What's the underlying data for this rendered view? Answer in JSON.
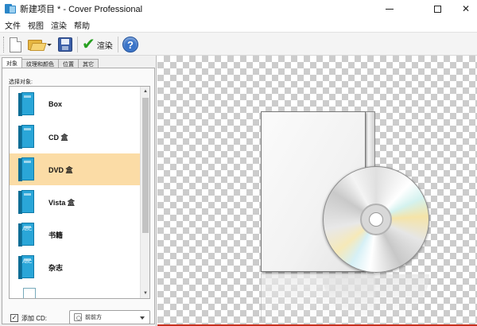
{
  "window": {
    "title": "新建项目 * - Cover Professional"
  },
  "menu": [
    "文件",
    "视图",
    "渲染",
    "帮助"
  ],
  "toolbar": {
    "render_label": "渲染",
    "help_glyph": "?"
  },
  "left_panel": {
    "tabs": [
      "对象",
      "纹理和颜色",
      "位置",
      "其它"
    ],
    "select_label": "选择对象:",
    "items": [
      {
        "label": "Box",
        "icon": "box-book-icon"
      },
      {
        "label": "CD 盒",
        "icon": "cd-case-icon"
      },
      {
        "label": "DVD 盒",
        "icon": "dvd-case-icon",
        "selected": true
      },
      {
        "label": "Vista 盒",
        "icon": "vista-box-icon"
      },
      {
        "label": "书籍",
        "icon": "book-icon",
        "cover_text": "ABC"
      },
      {
        "label": "杂志",
        "icon": "magazine-icon",
        "cover_text": "ABC"
      }
    ],
    "add_cd": {
      "label": "添加 CD:",
      "checked": true,
      "check_glyph": "✓"
    },
    "cd_position": {
      "value": "前前方"
    }
  },
  "preview": {
    "object": "DVD case with CD disc",
    "background": "transparent-checkerboard"
  }
}
